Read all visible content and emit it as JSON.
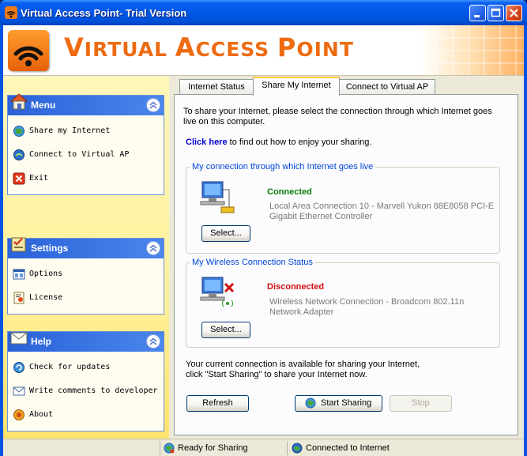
{
  "window": {
    "title": "Virtual Access Point- Trial Version",
    "colors": {
      "titlebar": "#0054e3",
      "accent_orange": "#ee6b12",
      "connected": "#0a7a0a",
      "disconnected": "#d01010",
      "link": "#0000cc"
    }
  },
  "banner": {
    "title_big_1": "V",
    "title_small_1": "IRTUAL ",
    "title_big_2": "A",
    "title_small_2": "CCESS ",
    "title_big_3": "P",
    "title_small_3": "OINT",
    "logo_icon": "wifi-icon"
  },
  "sidebar": {
    "menu": {
      "title": "Menu",
      "items": [
        {
          "label": "Share my Internet",
          "icon": "globe-share-icon"
        },
        {
          "label": "Connect to Virtual AP",
          "icon": "network-icon"
        },
        {
          "label": "Exit",
          "icon": "exit-icon"
        }
      ]
    },
    "settings": {
      "title": "Settings",
      "items": [
        {
          "label": "Options",
          "icon": "options-icon"
        },
        {
          "label": "License",
          "icon": "license-icon"
        }
      ]
    },
    "help": {
      "title": "Help",
      "items": [
        {
          "label": "Check for updates",
          "icon": "update-icon"
        },
        {
          "label": "Write comments to developer",
          "icon": "mail-icon"
        },
        {
          "label": "About",
          "icon": "about-icon"
        }
      ]
    }
  },
  "tabs": [
    {
      "label": "Internet Status",
      "active": false
    },
    {
      "label": "Share My Internet",
      "active": true
    },
    {
      "label": "Connect to Virtual AP",
      "active": false
    }
  ],
  "share": {
    "intro_line1": "To share your Internet, please select the connection through which Internet goes",
    "intro_line2": "live on this computer.",
    "click_here": "Click here",
    "click_here_rest": "to find out how to enjoy your sharing.",
    "my_connection": {
      "title": "My connection  through which Internet goes live",
      "status": "Connected",
      "desc_line1": "Local Area Connection 10 - Marvell Yukon 88E8058 PCI-E",
      "desc_line2": "Gigabit Ethernet Controller",
      "select_label": "Select..."
    },
    "wireless": {
      "title": "My Wireless Connection Status",
      "status": "Disconnected",
      "desc_line1": "Wireless Network Connection - Broadcom 802.11n",
      "desc_line2": "Network Adapter",
      "select_label": "Select..."
    },
    "note_line1": "Your current connection is available for sharing your Internet,",
    "note_line2": "click \"Start Sharing\" to share your Internet now.",
    "refresh_label": "Refresh",
    "start_label": "Start Sharing",
    "stop_label": "Stop"
  },
  "statusbar": {
    "sharing": "Ready for Sharing",
    "internet": "Connected to Internet"
  }
}
